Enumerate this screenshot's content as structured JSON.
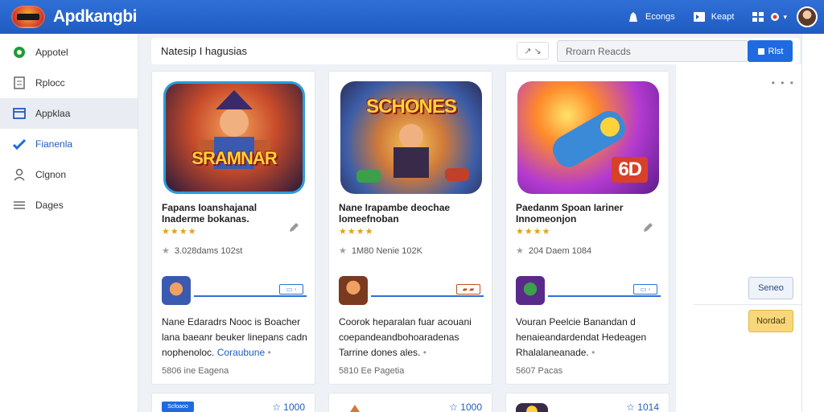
{
  "header": {
    "brand": "Apdkangbi",
    "actions": [
      {
        "label": "Econgs",
        "icon": "shirt-icon"
      },
      {
        "label": "Keapt",
        "icon": "key-card-icon"
      },
      {
        "label": "",
        "icon": "grid-icon"
      }
    ]
  },
  "sidebar": {
    "items": [
      {
        "label": "Appotel",
        "icon": "circle-logo-icon"
      },
      {
        "label": "Rplocc",
        "icon": "document-icon"
      },
      {
        "label": "Appklaa",
        "icon": "calendar-icon"
      },
      {
        "label": "Fianenla",
        "icon": "check-icon"
      },
      {
        "label": "Clgnon",
        "icon": "person-icon"
      },
      {
        "label": "Dages",
        "icon": "list-icon"
      }
    ]
  },
  "toolbar": {
    "title": "Natesip I hagusias",
    "tool_label": "↗ ↘",
    "search_placeholder": "Rroarn Reacds",
    "search_button": "Rlst"
  },
  "cards": [
    {
      "art_title": "SRAMNAR",
      "name": "Fapans Ioanshajanal Inaderme bokanas.",
      "stars": "★★★★",
      "meta": "3.028dams 102st",
      "desc": "Nane Edaradrs Nooc is Boacher lana baeanr beuker linepans cadn nophenoloc.",
      "desc_link": "Coraubune",
      "footer": "5806 ine Eagena"
    },
    {
      "art_title": "SCHONES",
      "name": "Nane Irapambe deochae lomeefnoban",
      "stars": "★★★★",
      "meta": "1M80 Nenie 102K",
      "desc": "Coorok heparalan fuar acouani coepandeandbohoaradenas Tarrine dones ales.",
      "desc_link": "",
      "footer": "5810 Ee Pagetia"
    },
    {
      "art_title": "6D",
      "name": "Paedanm Spoan Iariner Innomeonjon",
      "stars": "★★★★",
      "meta": "204 Daem 1084",
      "desc": "Vouran Peelcie Banandan d henaieandardendat Hedeagen Rhalalaneanade.",
      "desc_link": "",
      "footer": "5607 Pacas"
    }
  ],
  "bottom_cards": [
    {
      "tag": "Scfoaoo",
      "stat": "☆ 1000"
    },
    {
      "tag": "",
      "stat": "☆ 1000"
    },
    {
      "tag": "",
      "stat": "☆ 1014"
    }
  ],
  "right_panel": {
    "dots": "• • •",
    "button_primary": "Seneo",
    "button_secondary": "Nordad"
  },
  "colors": {
    "header": "#1f5cc2",
    "accent": "#1f6ae0",
    "star": "#e3a11c",
    "warning_button": "#f7d77a"
  }
}
